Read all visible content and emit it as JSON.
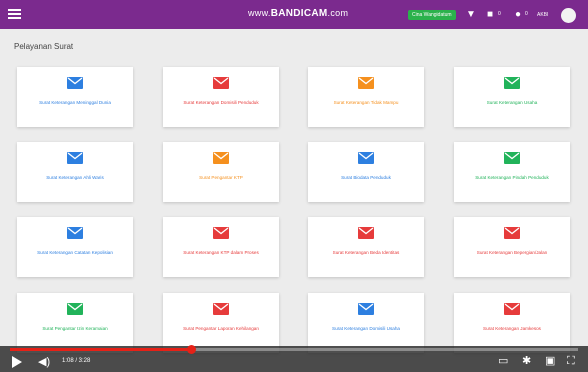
{
  "topbar": {
    "watermark_left": "www.",
    "watermark_brand": "BANDICAM",
    "watermark_right": ".com",
    "badge_label": "Cina Wangidatum",
    "count_1": "0",
    "count_2": "0",
    "user_label": "AKBI"
  },
  "page": {
    "title": "Pelayanan Surat"
  },
  "colors": {
    "blue": "#2d7fe0",
    "red": "#e63b3b",
    "orange": "#f5901e",
    "green": "#21b35a"
  },
  "cards": [
    {
      "label": "Surat Keterangan Meninggal Dunia",
      "color": "blue",
      "icon": "envelope-icon"
    },
    {
      "label": "Surat Keterangan Domisili Penduduk",
      "color": "red",
      "icon": "envelope-icon"
    },
    {
      "label": "Surat Keterangan Tidak Mampu",
      "color": "orange",
      "icon": "envelope-icon"
    },
    {
      "label": "Surat Keterangan Usaha",
      "color": "green",
      "icon": "envelope-icon"
    },
    {
      "label": "Surat Keterangan Ahli Waris",
      "color": "blue",
      "icon": "envelope-icon"
    },
    {
      "label": "Surat Pengantar KTP",
      "color": "orange",
      "icon": "envelope-icon"
    },
    {
      "label": "Surat Biodata Penduduk",
      "color": "blue",
      "icon": "envelope-icon"
    },
    {
      "label": "Surat Keterangan Pindah Penduduk",
      "color": "green",
      "icon": "envelope-icon"
    },
    {
      "label": "Surat Keterangan Catatan Kepolisian",
      "color": "blue",
      "icon": "envelope-icon"
    },
    {
      "label": "Surat Keterangan KTP dalam Proses",
      "color": "red",
      "icon": "envelope-icon"
    },
    {
      "label": "Surat Keterangan Beda Identitas",
      "color": "red",
      "icon": "envelope-icon"
    },
    {
      "label": "Surat Keterangan Bepergian/Jalan",
      "color": "red",
      "icon": "envelope-icon"
    },
    {
      "label": "Surat Pengantar Izin Keramaian",
      "color": "green",
      "icon": "envelope-icon"
    },
    {
      "label": "Surat Pengantar Laporan Kehilangan",
      "color": "red",
      "icon": "envelope-icon"
    },
    {
      "label": "Surat Keterangan Domisili Usaha",
      "color": "blue",
      "icon": "envelope-icon"
    },
    {
      "label": "Surat Keterangan Jamkesos",
      "color": "red",
      "icon": "envelope-icon"
    }
  ],
  "player": {
    "time": "1:08 / 3:28",
    "progress_fraction": 0.32
  }
}
